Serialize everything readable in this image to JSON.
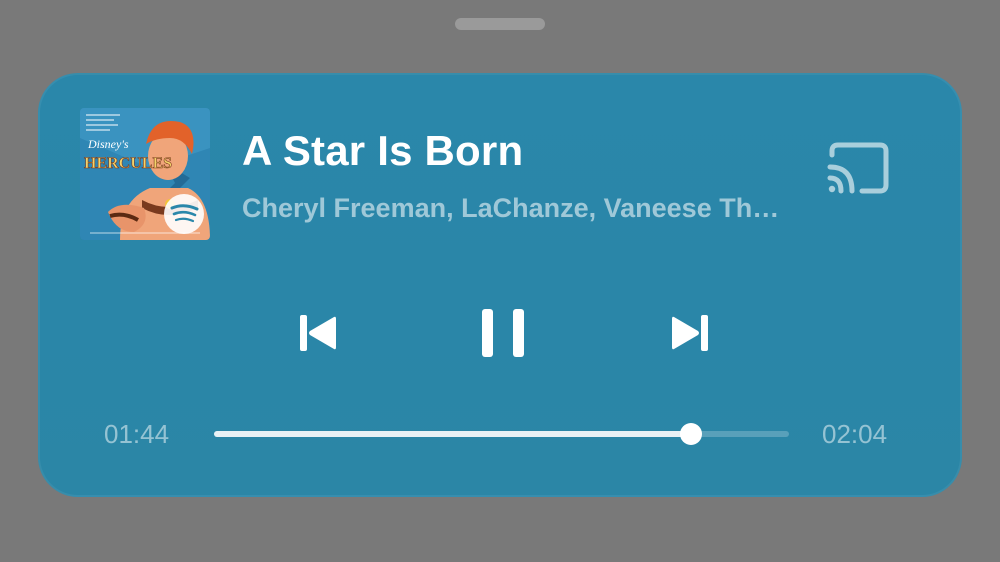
{
  "player": {
    "title": "A Star Is Born",
    "artist": "Cheryl Freeman, LaChanze, Vaneese Th…",
    "album_art": {
      "brand_line": "Disney's",
      "album_name": "HERCULES",
      "badge": "spotify-logo-icon"
    },
    "time_elapsed": "01:44",
    "time_total": "02:04",
    "progress": 0.83
  },
  "icons": {
    "cast": "cast-icon",
    "previous": "skip-previous-icon",
    "pause": "pause-icon",
    "next": "skip-next-icon"
  },
  "colors": {
    "card_background": "#2a87aa",
    "backdrop": "#797979",
    "accent": "#ffffff"
  }
}
